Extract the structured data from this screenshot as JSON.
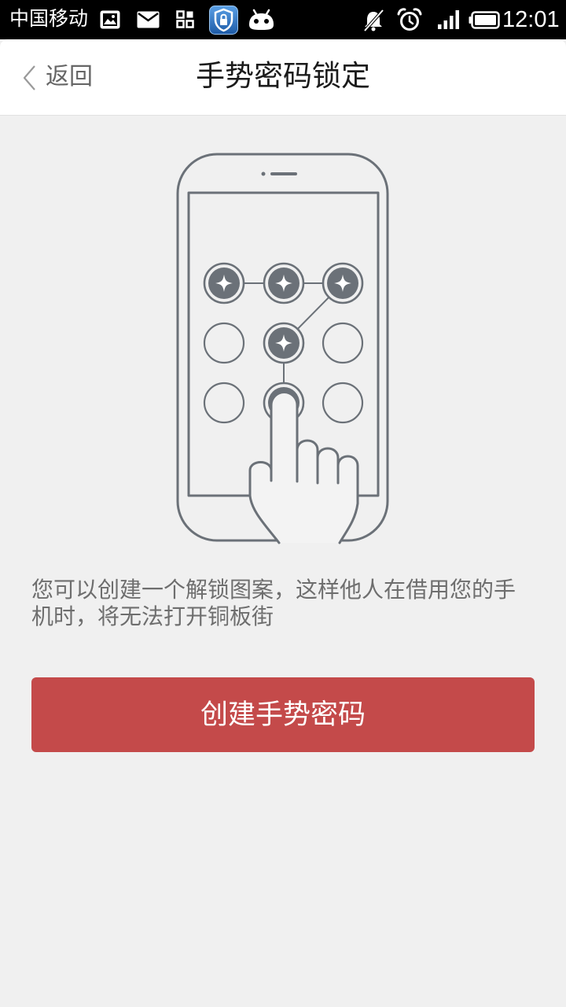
{
  "status_bar": {
    "carrier": "中国移动",
    "time": "12:01",
    "left_icons": [
      "gallery-icon",
      "mail-icon",
      "apps-grid-icon",
      "security-app-icon",
      "android-icon"
    ],
    "right_icons": [
      "notifications-off-icon",
      "alarm-icon",
      "signal-icon",
      "battery-icon"
    ]
  },
  "header": {
    "back_icon": "chevron-left-icon",
    "back_label": "返回",
    "title": "手势密码锁定"
  },
  "main": {
    "illustration": "phone-pattern-lock-illustration",
    "pattern_selected_dots": [
      1,
      2,
      3,
      5,
      8
    ],
    "description": "您可以创建一个解锁图案，这样他人在借用您的手机时，将无法打开铜板街",
    "create_button_label": "创建手势密码"
  },
  "colors": {
    "status_bar": "#000000",
    "header": "#ffffff",
    "background": "#f0f0f0",
    "primary_button": "#c44a4a",
    "illustration_stroke": "#6b7178"
  }
}
